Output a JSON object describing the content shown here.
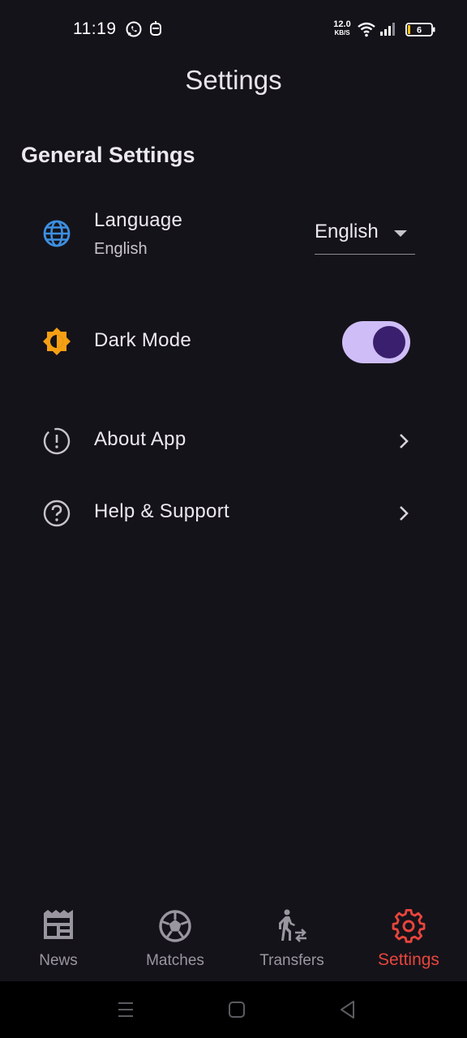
{
  "status_bar": {
    "time": "11:19",
    "net_speed_value": "12.0",
    "net_speed_unit": "KB/S",
    "battery_level": "6",
    "icons": [
      "whatsapp-icon",
      "notification-icon",
      "wifi-icon",
      "signal-icon",
      "battery-icon"
    ]
  },
  "header": {
    "title": "Settings"
  },
  "general": {
    "section_title": "General Settings",
    "language": {
      "label": "Language",
      "value": "English",
      "dropdown_value": "English"
    },
    "dark_mode": {
      "label": "Dark Mode",
      "enabled": true
    },
    "about": {
      "label": "About App"
    },
    "help": {
      "label": "Help & Support"
    }
  },
  "bottom_nav": {
    "items": [
      {
        "label": "News",
        "icon": "news-icon",
        "active": false
      },
      {
        "label": "Matches",
        "icon": "soccer-ball-icon",
        "active": false
      },
      {
        "label": "Transfers",
        "icon": "transfer-icon",
        "active": false
      },
      {
        "label": "Settings",
        "icon": "gear-icon",
        "active": true
      }
    ]
  },
  "colors": {
    "background": "#15131a",
    "accent_active": "#e8453c",
    "toggle_track": "#cfbdf7",
    "toggle_knob": "#3a1f6e",
    "globe_icon": "#3d8fe0",
    "dark_mode_icon": "#f5a014"
  }
}
